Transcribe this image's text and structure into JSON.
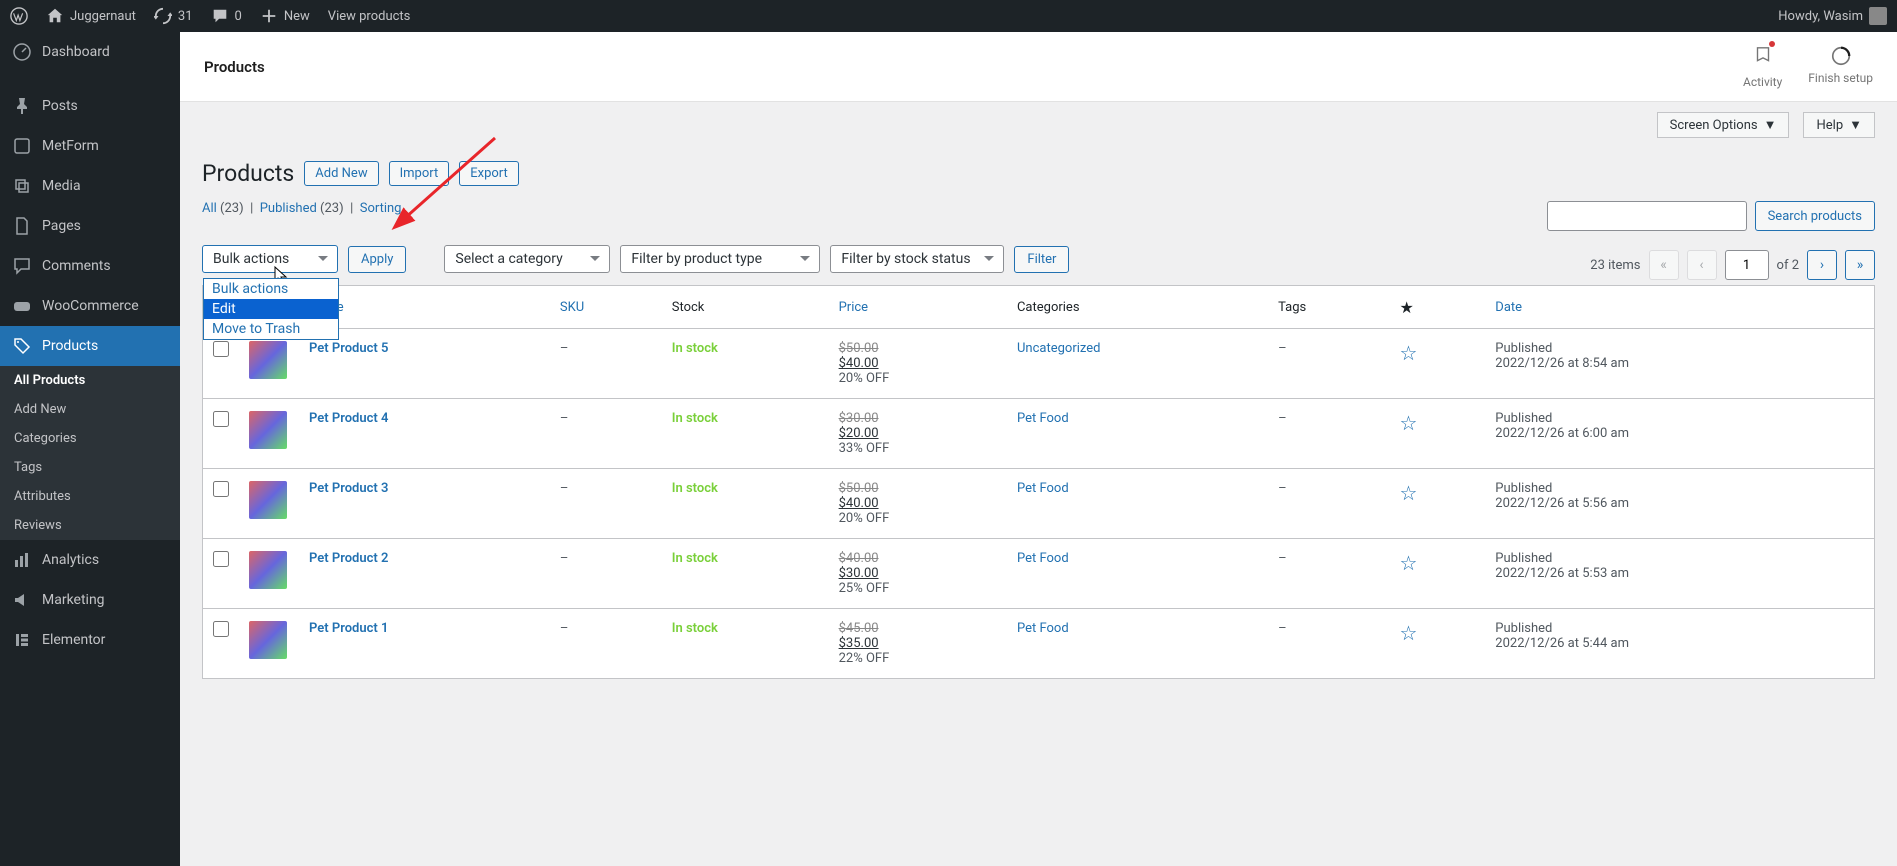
{
  "adminbar": {
    "site_name": "Juggernaut",
    "updates": "31",
    "comments": "0",
    "new_label": "New",
    "view_label": "View products",
    "greeting": "Howdy, Wasim"
  },
  "sidebar": {
    "items": [
      {
        "label": "Dashboard",
        "icon": "dashboard"
      },
      {
        "label": "Posts",
        "icon": "pin"
      },
      {
        "label": "MetForm",
        "icon": "metform"
      },
      {
        "label": "Media",
        "icon": "media"
      },
      {
        "label": "Pages",
        "icon": "page"
      },
      {
        "label": "Comments",
        "icon": "comment"
      },
      {
        "label": "WooCommerce",
        "icon": "woo"
      },
      {
        "label": "Products",
        "icon": "products",
        "active": true
      },
      {
        "label": "Analytics",
        "icon": "analytics"
      },
      {
        "label": "Marketing",
        "icon": "marketing"
      },
      {
        "label": "Elementor",
        "icon": "elementor"
      }
    ],
    "sub": [
      "All Products",
      "Add New",
      "Categories",
      "Tags",
      "Attributes",
      "Reviews"
    ]
  },
  "header": {
    "title": "Products",
    "activity": "Activity",
    "finish": "Finish setup"
  },
  "top_tabs": {
    "screen": "Screen Options",
    "help": "Help"
  },
  "page": {
    "h1": "Products",
    "add_new": "Add New",
    "import": "Import",
    "export": "Export"
  },
  "subsub": {
    "all": "All",
    "all_count": "(23)",
    "pub": "Published",
    "pub_count": "(23)",
    "sort": "Sorting"
  },
  "filters": {
    "bulk": "Bulk actions",
    "apply": "Apply",
    "category": "Select a category",
    "type": "Filter by product type",
    "stock": "Filter by stock status",
    "filter_btn": "Filter"
  },
  "dropdown": {
    "opt0": "Bulk actions",
    "opt1": "Edit",
    "opt2": "Move to Trash"
  },
  "paging": {
    "count": "23 items",
    "page": "1",
    "of": "of 2"
  },
  "search_btn": "Search products",
  "columns": {
    "name": "Name",
    "sku": "SKU",
    "stock": "Stock",
    "price": "Price",
    "categories": "Categories",
    "tags": "Tags",
    "date": "Date"
  },
  "rows": [
    {
      "name": "Pet Product 5",
      "sku": "–",
      "stock": "In stock",
      "old": "$50.00",
      "new": "$40.00",
      "off": "20% OFF",
      "cat": "Uncategorized",
      "tags": "–",
      "date_a": "Published",
      "date_b": "2022/12/26 at 8:54 am"
    },
    {
      "name": "Pet Product 4",
      "sku": "–",
      "stock": "In stock",
      "old": "$30.00",
      "new": "$20.00",
      "off": "33% OFF",
      "cat": "Pet Food",
      "tags": "–",
      "date_a": "Published",
      "date_b": "2022/12/26 at 6:00 am"
    },
    {
      "name": "Pet Product 3",
      "sku": "–",
      "stock": "In stock",
      "old": "$50.00",
      "new": "$40.00",
      "off": "20% OFF",
      "cat": "Pet Food",
      "tags": "–",
      "date_a": "Published",
      "date_b": "2022/12/26 at 5:56 am"
    },
    {
      "name": "Pet Product 2",
      "sku": "–",
      "stock": "In stock",
      "old": "$40.00",
      "new": "$30.00",
      "off": "25% OFF",
      "cat": "Pet Food",
      "tags": "–",
      "date_a": "Published",
      "date_b": "2022/12/26 at 5:53 am"
    },
    {
      "name": "Pet Product 1",
      "sku": "–",
      "stock": "In stock",
      "old": "$45.00",
      "new": "$35.00",
      "off": "22% OFF",
      "cat": "Pet Food",
      "tags": "–",
      "date_a": "Published",
      "date_b": "2022/12/26 at 5:44 am"
    }
  ]
}
